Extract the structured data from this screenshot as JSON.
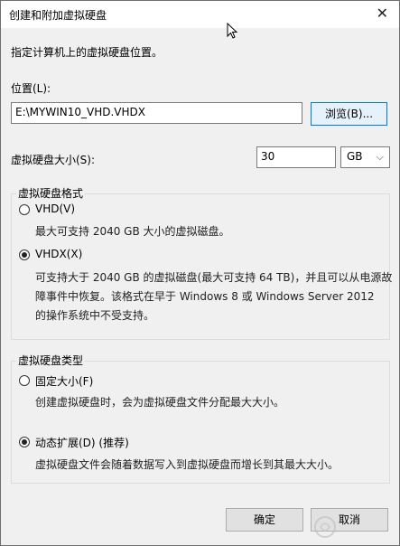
{
  "window": {
    "title": "创建和附加虚拟硬盘",
    "close_glyph": "✕"
  },
  "instruction": "指定计算机上的虚拟硬盘位置。",
  "location": {
    "label": "位置(L):",
    "value": "E:\\MYWIN10_VHD.VHDX",
    "browse_label": "浏览(B)..."
  },
  "size": {
    "label": "虚拟硬盘大小(S):",
    "value": "30",
    "unit": "GB"
  },
  "format": {
    "group_label": "虚拟硬盘格式",
    "vhd": {
      "label": "VHD(V)",
      "description": "最大可支持 2040 GB 大小的虚拟磁盘。",
      "checked": false
    },
    "vhdx": {
      "label": "VHDX(X)",
      "description_lines": [
        "可支持大于 2040 GB 的虚拟磁盘(最大可支持 64 TB)，并且可以从电源故",
        "障事件中恢复。该格式在早于 Windows 8 或 Windows Server 2012",
        "的操作系统中不受支持。"
      ],
      "checked": true
    }
  },
  "type": {
    "group_label": "虚拟硬盘类型",
    "fixed": {
      "label": "固定大小(F)",
      "description": "创建虚拟硬盘时，会为虚拟硬盘文件分配最大大小。",
      "checked": false
    },
    "dynamic": {
      "label": "动态扩展(D) (推荐)",
      "description": "虚拟硬盘文件会随着数据写入到虚拟硬盘而增长到其最大大小。",
      "checked": true
    }
  },
  "buttons": {
    "ok": "确定",
    "cancel": "取消"
  },
  "watermark": {
    "text": "fan.com.cn"
  },
  "colors": {
    "focus_border": "#0078d7",
    "dialog_bg": "#f0f0f0"
  }
}
